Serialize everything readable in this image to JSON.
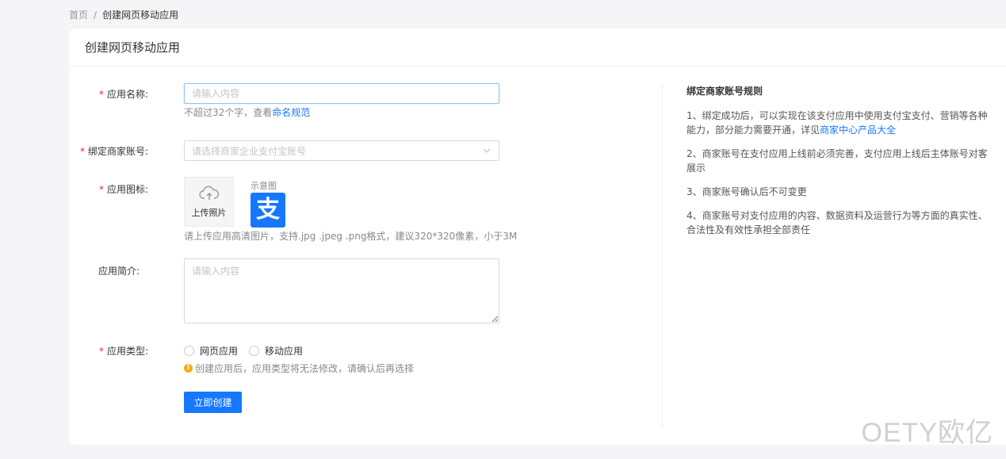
{
  "breadcrumb": {
    "home": "首页",
    "separator": "/",
    "current": "创建网页移动应用"
  },
  "page": {
    "title": "创建网页移动应用"
  },
  "form": {
    "app_name": {
      "label": "应用名称:",
      "placeholder": "请输入内容",
      "hint_prefix": "不超过32个字，查看",
      "hint_link": "命名规范"
    },
    "merchant": {
      "label": "绑定商家账号:",
      "placeholder": "请选择商家企业支付宝账号"
    },
    "icon": {
      "label": "应用图标:",
      "upload_label": "上传照片",
      "sample_label": "示意图",
      "sample_glyph": "支",
      "hint": "请上传应用高清图片，支持.jpg .jpeg .png格式，建议320*320像素，小于3M"
    },
    "intro": {
      "label": "应用简介:",
      "placeholder": "请输入内容"
    },
    "type": {
      "label": "应用类型:",
      "options": [
        "网页应用",
        "移动应用"
      ],
      "warning": "创建应用后，应用类型将无法修改，请确认后再选择",
      "warning_glyph": "!"
    },
    "submit_label": "立即创建"
  },
  "rules": {
    "title": "绑定商家账号规则",
    "items": [
      {
        "text": "1、绑定成功后，可以实现在该支付应用中使用支付宝支付、营销等各种能力，部分能力需要开通，详见",
        "link": "商家中心产品大全"
      },
      {
        "text": "2、商家账号在支付应用上线前必须完善，支付应用上线后主体账号对客展示"
      },
      {
        "text": "3、商家账号确认后不可变更"
      },
      {
        "text": "4、商家账号对支付应用的内容、数据资料及运营行为等方面的真实性、合法性及有效性承担全部责任"
      }
    ]
  },
  "watermark": "OETY欧亿",
  "colors": {
    "primary": "#1677ff",
    "required": "#f5222d",
    "warning": "#faad14",
    "background": "#f5f5f7"
  },
  "icons": {
    "upload": "cloud-upload-icon",
    "select_arrow": "chevron-down-icon",
    "warning": "exclamation-circle-icon",
    "sample": "alipay-logo"
  }
}
